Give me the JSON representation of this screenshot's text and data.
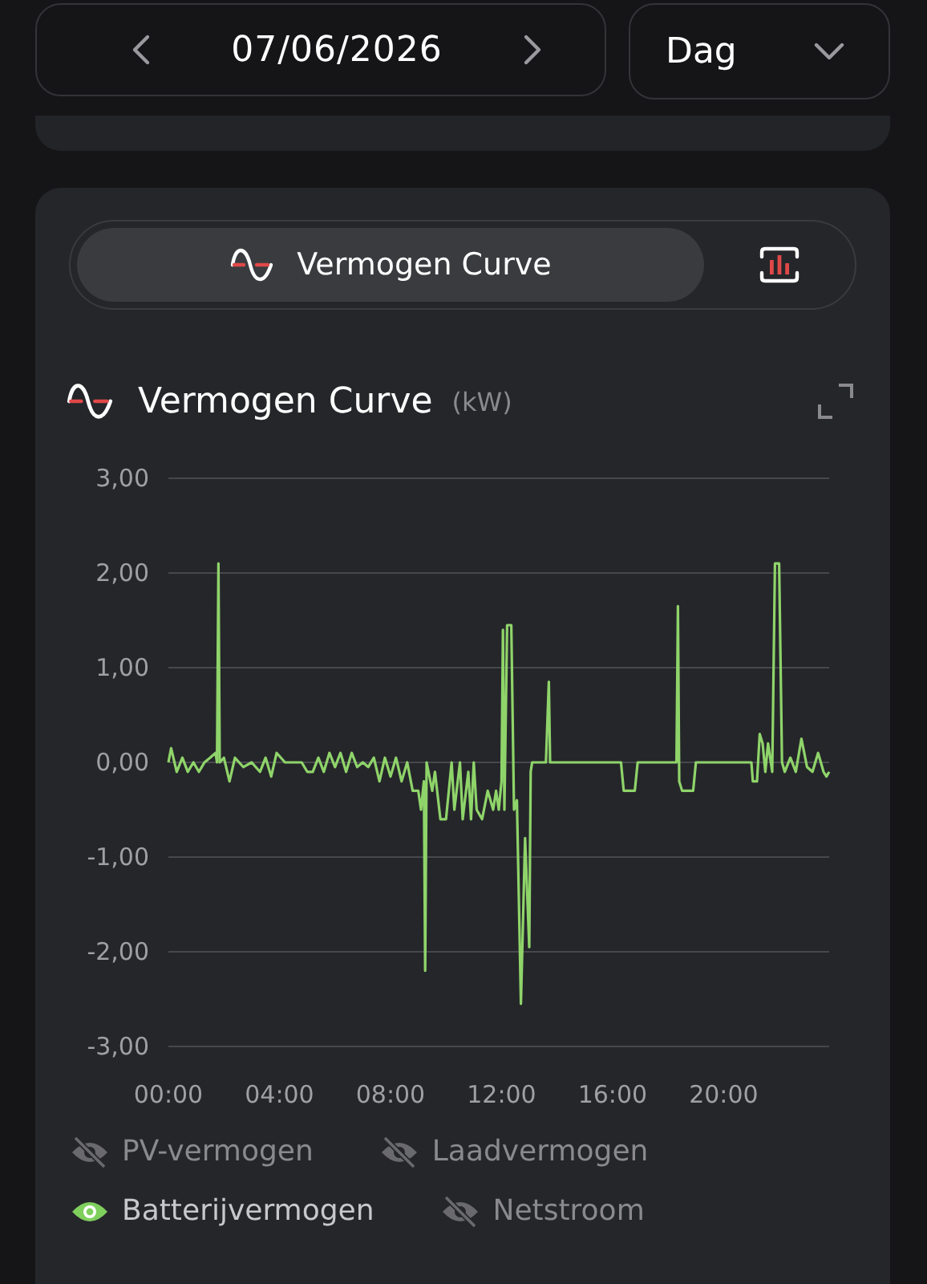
{
  "date_nav": {
    "date": "07/06/2026"
  },
  "period_select": {
    "value": "Dag"
  },
  "view_tabs": [
    {
      "kind": "curve",
      "label": "Vermogen Curve",
      "selected": true
    },
    {
      "kind": "bars",
      "selected": false
    }
  ],
  "chart_card": {
    "title": "Vermogen Curve",
    "unit": "(kW)",
    "chart_data": {
      "type": "line",
      "x": [
        0,
        0.1,
        0.3,
        0.5,
        0.7,
        0.9,
        1.1,
        1.3,
        1.5,
        1.7,
        1.75,
        1.8,
        1.85,
        2.0,
        2.2,
        2.4,
        2.7,
        3.0,
        3.3,
        3.5,
        3.7,
        3.9,
        4.2,
        4.5,
        4.8,
        5.0,
        5.2,
        5.4,
        5.6,
        5.8,
        6.0,
        6.2,
        6.4,
        6.6,
        6.8,
        7.0,
        7.2,
        7.4,
        7.6,
        7.8,
        8.0,
        8.2,
        8.4,
        8.6,
        8.8,
        9.0,
        9.1,
        9.2,
        9.25,
        9.3,
        9.5,
        9.6,
        9.8,
        10.0,
        10.2,
        10.3,
        10.5,
        10.6,
        10.8,
        10.9,
        11.0,
        11.1,
        11.3,
        11.5,
        11.7,
        11.8,
        11.9,
        12.0,
        12.05,
        12.1,
        12.2,
        12.35,
        12.45,
        12.55,
        12.7,
        12.85,
        13.0,
        13.05,
        13.1,
        13.6,
        13.7,
        13.75,
        16.3,
        16.4,
        16.8,
        16.9,
        18.3,
        18.35,
        18.4,
        18.5,
        18.9,
        19.0,
        21.0,
        21.05,
        21.2,
        21.3,
        21.4,
        21.5,
        21.6,
        21.75,
        21.85,
        22.0,
        22.1,
        22.2,
        22.4,
        22.6,
        22.8,
        23.0,
        23.2,
        23.4,
        23.6,
        23.7,
        23.8
      ],
      "series": [
        {
          "color": "#8fd46a",
          "values": [
            0,
            0.15,
            -0.1,
            0.05,
            -0.1,
            0,
            -0.1,
            0,
            0.05,
            0.1,
            0,
            2.1,
            0,
            0.05,
            -0.2,
            0.05,
            -0.05,
            0,
            -0.1,
            0.05,
            -0.15,
            0.1,
            0,
            0,
            0,
            -0.1,
            -0.1,
            0.05,
            -0.1,
            0.1,
            -0.05,
            0.1,
            -0.1,
            0.1,
            -0.05,
            0,
            -0.05,
            0.05,
            -0.2,
            0.05,
            -0.15,
            0.05,
            -0.2,
            0,
            -0.3,
            -0.3,
            -0.5,
            -0.2,
            -2.2,
            0,
            -0.3,
            -0.1,
            -0.6,
            -0.6,
            0,
            -0.5,
            0,
            -0.6,
            -0.1,
            -0.6,
            0,
            -0.5,
            -0.6,
            -0.3,
            -0.5,
            -0.3,
            -0.5,
            -0.2,
            1.4,
            -0.5,
            1.45,
            1.45,
            -0.5,
            -0.4,
            -2.55,
            -0.8,
            -1.95,
            -0.1,
            0,
            0,
            0.85,
            0,
            0,
            -0.3,
            -0.3,
            0,
            0,
            1.65,
            -0.2,
            -0.3,
            -0.3,
            0,
            0,
            -0.2,
            -0.2,
            0.3,
            0.2,
            -0.1,
            0.2,
            -0.1,
            2.1,
            2.1,
            0,
            -0.1,
            0.05,
            -0.1,
            0.25,
            -0.05,
            -0.1,
            0.1,
            -0.1,
            -0.15,
            -0.1
          ]
        }
      ],
      "xlim": [
        0,
        23.8
      ],
      "ylim": [
        -3,
        3
      ],
      "grid": true,
      "xticks": [
        {
          "value": 0,
          "label": "00:00"
        },
        {
          "value": 4,
          "label": "04:00"
        },
        {
          "value": 8,
          "label": "08:00"
        },
        {
          "value": 12,
          "label": "12:00"
        },
        {
          "value": 16,
          "label": "16:00"
        },
        {
          "value": 20,
          "label": "20:00"
        }
      ],
      "yticks": [
        {
          "value": 3,
          "label": "3,00"
        },
        {
          "value": 2,
          "label": "2,00"
        },
        {
          "value": 1,
          "label": "1,00"
        },
        {
          "value": 0,
          "label": "0,00"
        },
        {
          "value": -1,
          "label": "-1,00"
        },
        {
          "value": -2,
          "label": "-2,00"
        },
        {
          "value": -3,
          "label": "-3,00"
        }
      ]
    },
    "legend": [
      {
        "label": "PV-vermogen",
        "visible": false
      },
      {
        "label": "Laadvermogen",
        "visible": false
      },
      {
        "label": "Batterijvermogen",
        "visible": true
      },
      {
        "label": "Netstroom",
        "visible": false
      }
    ]
  }
}
